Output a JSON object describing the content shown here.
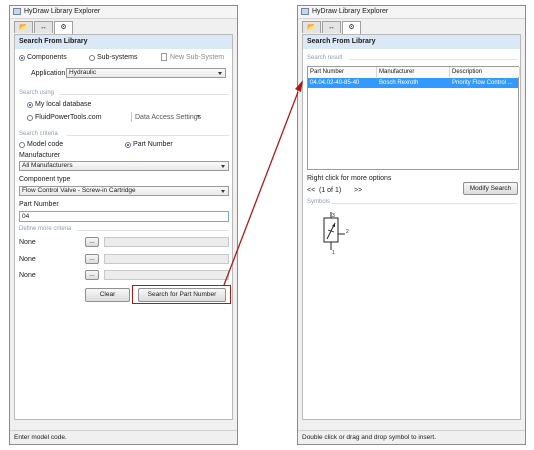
{
  "left": {
    "title": "HyDraw Library Explorer",
    "tab_icons": [
      "folder-icon",
      "transfer-icon",
      "search-tool-icon"
    ],
    "header": "Search From Library",
    "type_options": [
      "Components",
      "Sub-systems"
    ],
    "new_subsystem": "New Sub-System",
    "application_label": "Application",
    "application_value": "Hydraulic",
    "search_using_label": "Search using",
    "database_options": [
      "My local database",
      "FluidPowerTools.com"
    ],
    "data_access": "Data Access Settings",
    "criteria_label": "Search criteria",
    "criteria_options": [
      "Model code",
      "Part Number"
    ],
    "manufacturer_label": "Manufacturer",
    "manufacturer_value": "All Manufacturers",
    "component_type_label": "Component type",
    "component_type_value": "Flow Control Valve - Screw-in Cartridge",
    "part_number_label": "Part Number",
    "part_number_value": "04",
    "more_criteria_label": "Define more criteria",
    "criteria_rows": [
      "None",
      "None",
      "None"
    ],
    "ellipsis": "...",
    "clear": "Clear",
    "search_button": "Search for Part Number",
    "status": "Enter model code."
  },
  "right": {
    "title": "HyDraw Library Explorer",
    "header": "Search From Library",
    "result_label": "Search result",
    "columns": [
      "Part Number",
      "Manufacturer",
      "Description"
    ],
    "rows": [
      {
        "part": "04.04.02-40-85-40",
        "manufacturer": "Bosch Rexroth",
        "description": "Priority Flow Control ..."
      }
    ],
    "hint": "Right click for more options",
    "pager": {
      "prev": "<<",
      "info": "(1 of 1)",
      "next": ">>"
    },
    "modify": "Modify Search",
    "symbols_label": "Symbols",
    "port_labels": [
      "3",
      "2",
      "1"
    ],
    "status": "Double click or drag and drop symbol to insert."
  },
  "colors": {
    "accent": "#3399ff",
    "highlight": "#b01818",
    "header": "#dbe8f6"
  }
}
